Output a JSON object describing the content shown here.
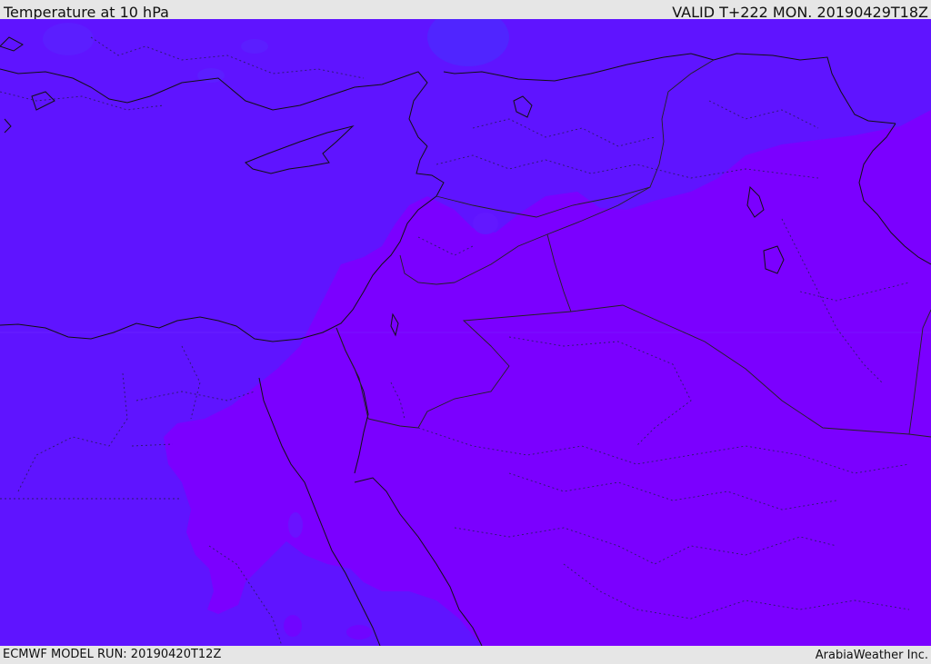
{
  "header": {
    "title": "Temperature at 10 hPa",
    "valid": "VALID T+222 MON. 20190429T18Z"
  },
  "footer": {
    "model_run": "ECMWF MODEL RUN: 20190420T12Z",
    "credit": "ArabiaWeather Inc."
  },
  "colors": {
    "warm_field": "#7b00ff",
    "cool_field": "#5f14ff",
    "cold_patch": "#4a2cff",
    "coastline": "#111111",
    "border": "#222222"
  }
}
